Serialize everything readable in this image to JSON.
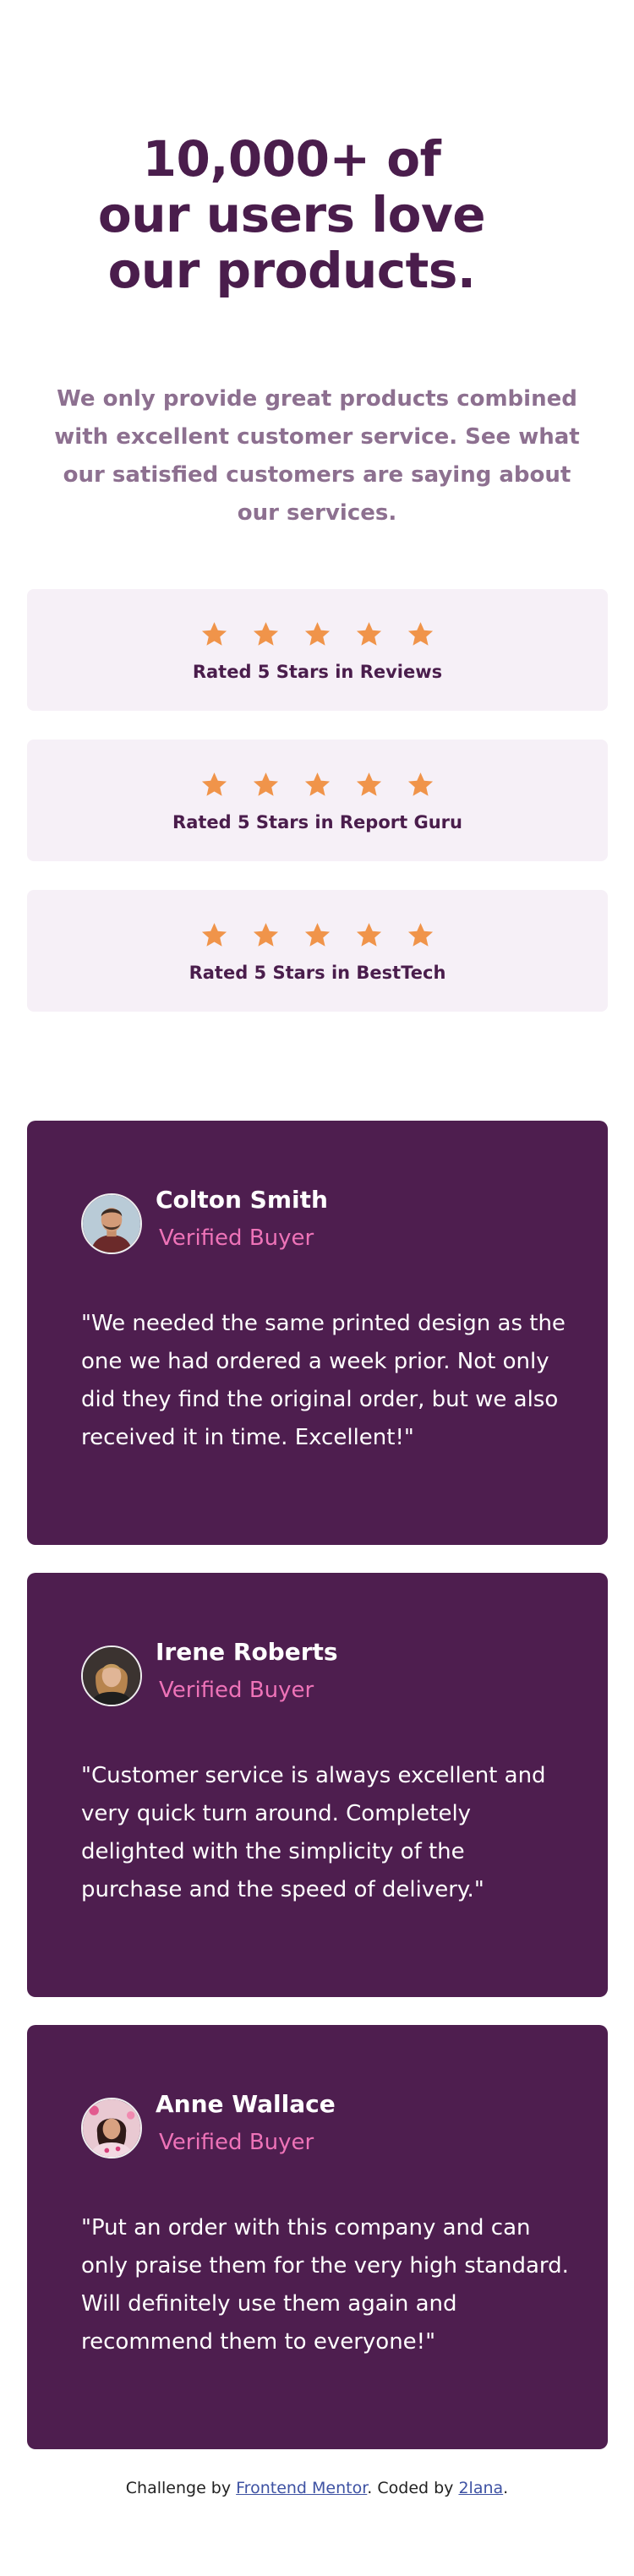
{
  "hero": {
    "title": "10,000+ of our users love our products.",
    "subtitle": "We only provide great products combined with excellent customer service. See what our satisfied customers are saying about our services."
  },
  "ratings": [
    {
      "stars": 5,
      "label": "Rated 5 Stars in Reviews"
    },
    {
      "stars": 5,
      "label": "Rated 5 Stars in Report Guru"
    },
    {
      "stars": 5,
      "label": "Rated 5 Stars in BestTech"
    }
  ],
  "testimonials": [
    {
      "name": "Colton Smith",
      "status": "Verified Buyer",
      "quote": "\"We needed the same printed design as the one we had ordered a week prior. Not only did they find the original order, but we also received it in time. Excellent!\"",
      "avatar_icon": "avatar-colton-icon"
    },
    {
      "name": "Irene Roberts",
      "status": "Verified Buyer",
      "quote": "\"Customer service is always excellent and very quick turn around. Completely delighted with the simplicity of the purchase and the speed of delivery.\"",
      "avatar_icon": "avatar-irene-icon"
    },
    {
      "name": "Anne Wallace",
      "status": "Verified Buyer",
      "quote": "\"Put an order with this company and can only praise them for the very high standard. Will definitely use them again and recommend them to everyone!\"",
      "avatar_icon": "avatar-anne-icon"
    }
  ],
  "footer": {
    "prefix": "Challenge by ",
    "link1_text": "Frontend Mentor",
    "middle": ". Coded by ",
    "link2_text": "2lana",
    "suffix": "."
  },
  "colors": {
    "dark_magenta": "#4a1d4c",
    "card_purple": "#4e1e4f",
    "soft_pink": "#ee73b8",
    "light_gray_pink": "#f6f0f7",
    "grayish_magenta": "#8d7090",
    "star_orange": "#f0944a"
  }
}
